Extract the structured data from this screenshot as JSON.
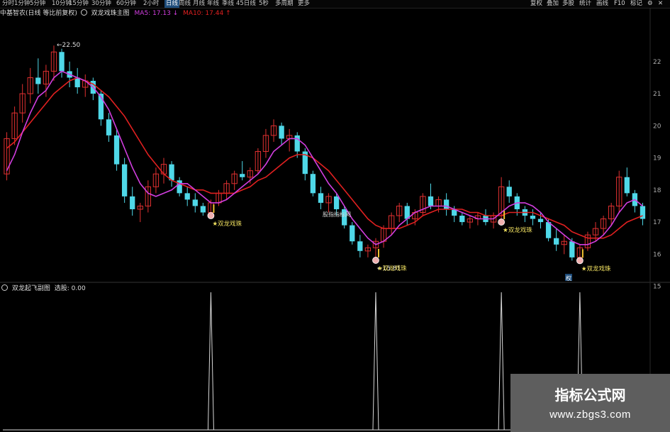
{
  "toolbar": {
    "periods": [
      "分时",
      "1分钟",
      "5分钟",
      "10分钟",
      "15分钟",
      "30分钟",
      "60分钟",
      "2小时",
      "日线",
      "周线",
      "月线",
      "年线",
      "季线",
      "45日线",
      "5秒",
      "多周期",
      "更多"
    ],
    "active_period": "日线",
    "right_buttons": [
      "复权",
      "叠加",
      "多股",
      "统计",
      "画线",
      "F10",
      "标记"
    ]
  },
  "main_header": {
    "stock": "中基智农(日线 等比前复权)",
    "indicator": "双龙戏珠主图",
    "ma5_label": "MA5: 17.13",
    "ma10_label": "MA10: 17.44"
  },
  "indicator_header": {
    "name": "双龙起飞副图",
    "value_label": "选股: 0.00"
  },
  "price_axis": [
    "22",
    "21",
    "20",
    "19",
    "18",
    "17",
    "16",
    "15"
  ],
  "annotations": {
    "high": "22.50",
    "low": "15.81",
    "signal_text": "★双龙戏珠",
    "watermark_label": "股指指标网",
    "rights_marker": "权"
  },
  "watermark": {
    "title": "指标公式网",
    "url": "www.zbgs3.com"
  },
  "colors": {
    "up": "#e03030",
    "down": "#4fd8e8",
    "ma_short": "#d23ee0",
    "ma_long": "#e02020",
    "signal_marker": "#f0b0b0",
    "signal_text": "#f0e060",
    "spike": "#d8d8d8"
  },
  "chart_data": {
    "type": "candlestick",
    "price_range": [
      15.3,
      23.3
    ],
    "candles": [
      [
        18.5,
        19.8,
        18.3,
        19.6
      ],
      [
        19.6,
        20.6,
        19.4,
        20.4
      ],
      [
        20.4,
        21.3,
        20.1,
        21.0
      ],
      [
        21.0,
        21.8,
        20.7,
        21.5
      ],
      [
        21.5,
        22.1,
        21.0,
        21.3
      ],
      [
        21.3,
        21.9,
        20.9,
        21.7
      ],
      [
        21.7,
        22.5,
        21.4,
        22.3
      ],
      [
        22.3,
        22.4,
        21.5,
        21.7
      ],
      [
        21.7,
        22.0,
        21.2,
        21.5
      ],
      [
        21.5,
        21.8,
        21.0,
        21.2
      ],
      [
        21.2,
        21.6,
        20.9,
        21.4
      ],
      [
        21.4,
        21.5,
        20.8,
        21.0
      ],
      [
        21.0,
        21.1,
        20.0,
        20.2
      ],
      [
        20.2,
        20.4,
        19.5,
        19.7
      ],
      [
        19.7,
        19.9,
        18.6,
        18.8
      ],
      [
        18.8,
        19.0,
        17.6,
        17.8
      ],
      [
        17.8,
        18.1,
        17.2,
        17.4
      ],
      [
        17.4,
        17.6,
        17.0,
        17.5
      ],
      [
        17.5,
        18.3,
        17.3,
        18.1
      ],
      [
        18.1,
        18.7,
        17.9,
        18.5
      ],
      [
        18.5,
        19.0,
        18.2,
        18.8
      ],
      [
        18.8,
        18.9,
        18.1,
        18.3
      ],
      [
        18.3,
        18.4,
        17.8,
        17.9
      ],
      [
        17.9,
        18.1,
        17.5,
        17.7
      ],
      [
        17.7,
        17.9,
        17.3,
        17.5
      ],
      [
        17.5,
        17.6,
        17.2,
        17.3
      ],
      [
        17.3,
        17.7,
        17.2,
        17.6
      ],
      [
        17.6,
        18.0,
        17.5,
        17.9
      ],
      [
        17.9,
        18.3,
        17.7,
        18.2
      ],
      [
        18.2,
        18.6,
        18.0,
        18.5
      ],
      [
        18.5,
        18.9,
        18.3,
        18.4
      ],
      [
        18.4,
        18.7,
        18.2,
        18.6
      ],
      [
        18.6,
        19.3,
        18.5,
        19.2
      ],
      [
        19.2,
        19.9,
        19.0,
        19.7
      ],
      [
        19.7,
        20.2,
        19.5,
        20.0
      ],
      [
        20.0,
        20.1,
        19.4,
        19.6
      ],
      [
        19.6,
        19.9,
        19.2,
        19.7
      ],
      [
        19.7,
        19.8,
        19.0,
        19.2
      ],
      [
        19.2,
        19.3,
        18.3,
        18.5
      ],
      [
        18.5,
        18.6,
        17.8,
        17.9
      ],
      [
        17.9,
        18.1,
        17.4,
        17.6
      ],
      [
        17.6,
        17.9,
        17.3,
        17.8
      ],
      [
        17.8,
        17.9,
        17.2,
        17.4
      ],
      [
        17.4,
        17.5,
        16.8,
        16.9
      ],
      [
        16.9,
        17.0,
        16.3,
        16.4
      ],
      [
        16.4,
        16.6,
        15.9,
        16.1
      ],
      [
        16.1,
        16.3,
        15.9,
        16.2
      ],
      [
        16.2,
        16.5,
        15.81,
        16.4
      ],
      [
        16.4,
        16.9,
        16.2,
        16.8
      ],
      [
        16.8,
        17.3,
        16.6,
        17.2
      ],
      [
        17.2,
        17.6,
        17.0,
        17.5
      ],
      [
        17.5,
        17.6,
        16.9,
        17.1
      ],
      [
        17.1,
        17.4,
        16.9,
        17.3
      ],
      [
        17.3,
        17.9,
        17.2,
        17.8
      ],
      [
        17.8,
        18.2,
        17.4,
        17.5
      ],
      [
        17.5,
        17.8,
        17.3,
        17.7
      ],
      [
        17.7,
        17.9,
        17.2,
        17.4
      ],
      [
        17.4,
        17.5,
        17.0,
        17.2
      ],
      [
        17.2,
        17.3,
        16.9,
        17.0
      ],
      [
        17.0,
        17.2,
        16.8,
        17.1
      ],
      [
        17.1,
        17.3,
        16.9,
        17.2
      ],
      [
        17.2,
        17.4,
        16.9,
        17.0
      ],
      [
        17.0,
        17.3,
        16.8,
        17.2
      ],
      [
        17.2,
        18.4,
        17.0,
        18.1
      ],
      [
        18.1,
        18.3,
        17.6,
        17.8
      ],
      [
        17.8,
        17.9,
        17.2,
        17.4
      ],
      [
        17.4,
        17.5,
        17.0,
        17.2
      ],
      [
        17.2,
        17.4,
        16.9,
        17.1
      ],
      [
        17.1,
        17.3,
        16.8,
        17.0
      ],
      [
        17.0,
        17.1,
        16.4,
        16.5
      ],
      [
        16.5,
        16.8,
        16.1,
        16.3
      ],
      [
        16.3,
        16.6,
        16.0,
        16.4
      ],
      [
        16.4,
        16.5,
        15.8,
        15.9
      ],
      [
        15.9,
        16.3,
        15.8,
        16.2
      ],
      [
        16.2,
        16.7,
        16.1,
        16.6
      ],
      [
        16.6,
        17.0,
        16.4,
        16.8
      ],
      [
        16.8,
        17.2,
        16.6,
        17.1
      ],
      [
        17.1,
        17.6,
        16.9,
        17.5
      ],
      [
        17.5,
        18.6,
        17.3,
        18.4
      ],
      [
        18.4,
        18.7,
        17.8,
        17.9
      ],
      [
        17.9,
        18.0,
        17.3,
        17.5
      ],
      [
        17.5,
        17.6,
        16.9,
        17.1
      ]
    ],
    "ma_short": [
      18.6,
      19.1,
      19.8,
      20.4,
      20.9,
      21.1,
      21.5,
      21.7,
      21.6,
      21.5,
      21.4,
      21.2,
      20.9,
      20.5,
      19.9,
      19.3,
      18.7,
      18.2,
      17.9,
      17.8,
      17.9,
      18.0,
      18.2,
      18.2,
      18.0,
      17.8,
      17.6,
      17.6,
      17.7,
      17.9,
      18.1,
      18.3,
      18.5,
      18.8,
      19.2,
      19.4,
      19.6,
      19.6,
      19.4,
      19.0,
      18.6,
      18.2,
      17.9,
      17.5,
      17.1,
      16.8,
      16.5,
      16.3,
      16.4,
      16.6,
      16.9,
      17.1,
      17.3,
      17.4,
      17.5,
      17.5,
      17.5,
      17.4,
      17.3,
      17.2,
      17.1,
      17.1,
      17.1,
      17.3,
      17.5,
      17.6,
      17.6,
      17.5,
      17.3,
      17.0,
      16.8,
      16.6,
      16.4,
      16.3,
      16.3,
      16.4,
      16.6,
      16.9,
      17.3,
      17.6,
      17.7,
      17.5
    ],
    "ma_long": [
      19.3,
      19.5,
      19.8,
      20.1,
      20.4,
      20.7,
      21.0,
      21.2,
      21.4,
      21.5,
      21.4,
      21.3,
      21.1,
      20.9,
      20.6,
      20.3,
      19.9,
      19.5,
      19.1,
      18.8,
      18.5,
      18.3,
      18.2,
      18.1,
      18.0,
      18.0,
      17.9,
      17.9,
      17.9,
      17.9,
      18.0,
      18.1,
      18.3,
      18.4,
      18.6,
      18.8,
      19.0,
      19.1,
      19.1,
      19.0,
      18.8,
      18.6,
      18.3,
      18.0,
      17.7,
      17.4,
      17.1,
      16.9,
      16.8,
      16.8,
      16.8,
      16.9,
      17.0,
      17.2,
      17.3,
      17.4,
      17.4,
      17.4,
      17.4,
      17.3,
      17.3,
      17.2,
      17.2,
      17.2,
      17.3,
      17.3,
      17.3,
      17.3,
      17.2,
      17.1,
      17.0,
      16.9,
      16.7,
      16.6,
      16.5,
      16.5,
      16.5,
      16.6,
      16.8,
      17.0,
      17.1,
      17.2
    ],
    "signal_candles": [
      26,
      47,
      63,
      73
    ],
    "indicator_range": [
      0,
      1
    ],
    "indicator_values": "spike to 1 at each signal candle, 0 elsewhere"
  }
}
